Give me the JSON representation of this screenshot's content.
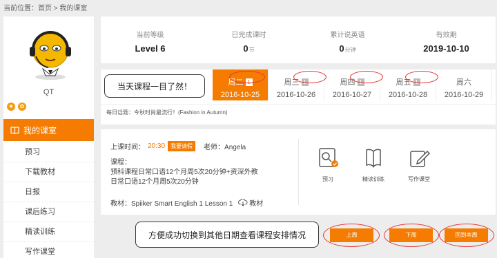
{
  "breadcrumb": "当前位置：首页 > 我的课室",
  "user": {
    "name": "QT"
  },
  "sidebar": {
    "active": "我的课室",
    "items": [
      "预习",
      "下载教材",
      "日报",
      "课后练习",
      "精读训练",
      "写作课堂"
    ]
  },
  "stats": [
    {
      "label": "当前等级",
      "value": "Level 6",
      "unit": ""
    },
    {
      "label": "已完成课时",
      "value": "0",
      "unit": "节"
    },
    {
      "label": "累计说英语",
      "value": "0",
      "unit": "分钟"
    },
    {
      "label": "有效期",
      "value": "2019-10-10",
      "unit": ""
    }
  ],
  "days": [
    {
      "name": "周二",
      "count": "1",
      "date": "2016-10-25"
    },
    {
      "name": "周三",
      "count": "1",
      "date": "2016-10-26"
    },
    {
      "name": "周四",
      "count": "1",
      "date": "2016-10-27"
    },
    {
      "name": "周五",
      "count": "1",
      "date": "2016-10-28"
    },
    {
      "name": "周六",
      "count": "",
      "date": "2016-10-29"
    }
  ],
  "topic": "每日话题：今秋时尚最流行！(Fashion in Autumn)",
  "callouts": {
    "top": "当天课程一目了然！",
    "bottom": "方便成功切换到其他日期查看课程安排情况"
  },
  "lesson": {
    "time_label": "上课时间：",
    "time": "20:30",
    "leave_label": "我要请假",
    "teacher": "老师：Angela",
    "course_label": "课程：",
    "course_line1": "预科课程日常口语12个月周5次20分钟+资深外教",
    "course_line2": "日常口语12个月周5次20分钟",
    "material_label": "教材：Spiiker Smart English 1 Lesson 1",
    "material_link": "教材",
    "tools": [
      "预习",
      "精读训练",
      "写作课堂"
    ]
  },
  "buttons": {
    "prev": "上周",
    "next": "下周",
    "current": "回到本周"
  },
  "colors": {
    "accent": "#f57c00",
    "highlight": "#e53935"
  }
}
